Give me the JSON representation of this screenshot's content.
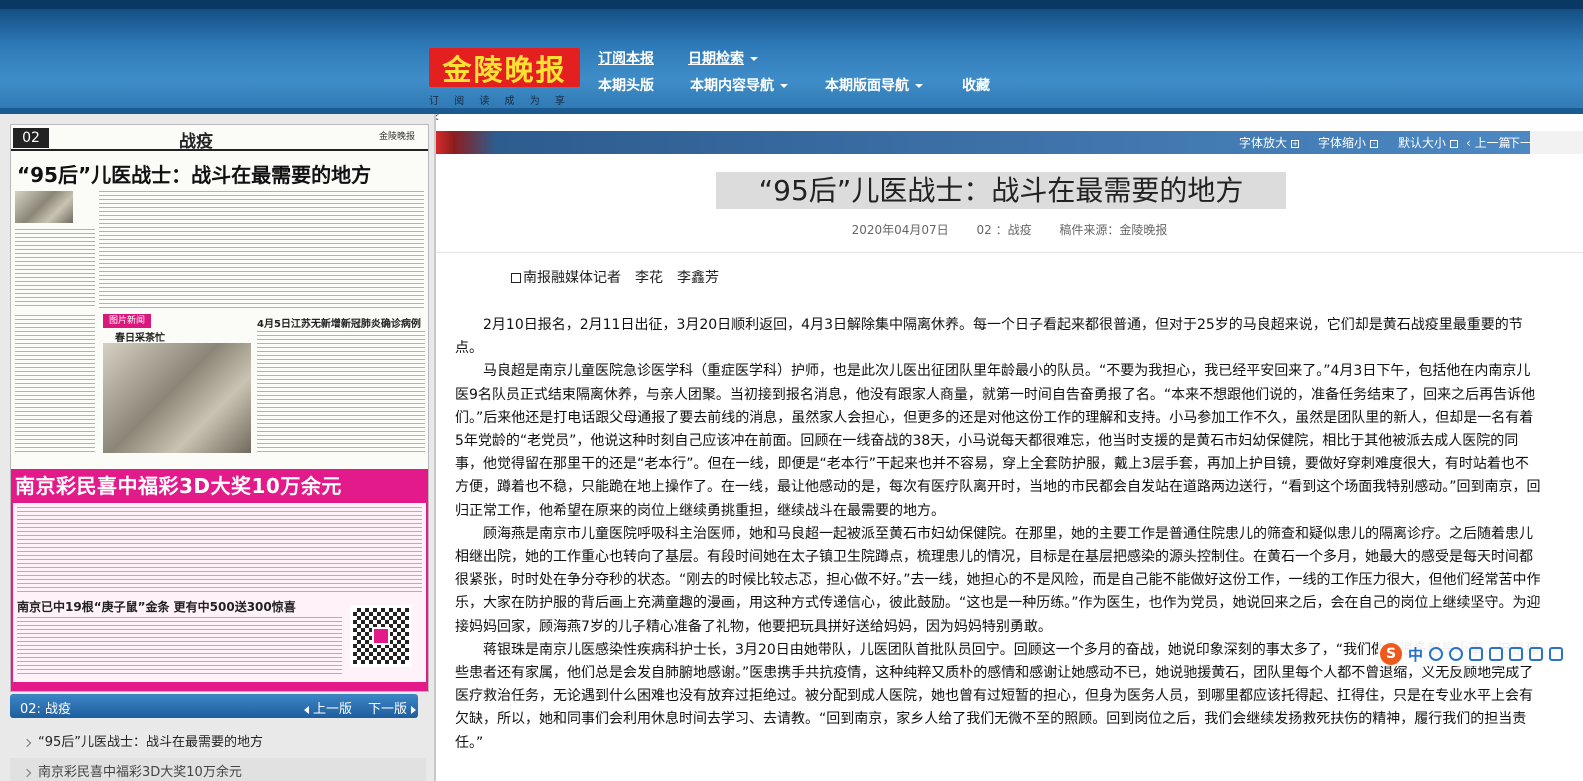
{
  "header": {
    "logo_text": "金陵晚报",
    "logo_slogan": "订 阅 读 成 为 享 受",
    "nav": {
      "subscribe": "订阅本报",
      "date_search": "日期检索",
      "front_page": "本期头版",
      "content_nav": "本期内容导航",
      "layout_nav": "本期版面导航",
      "favorite": "收藏"
    }
  },
  "paper_page": {
    "page_no": "02",
    "section": "战疫",
    "masthead": "金陵晚报",
    "headline": "“95后”儿医战士：战斗在最需要的地方",
    "photo_section_tag": "图片新闻",
    "photo_caption": "春日采茶忙",
    "side_headline": "4月5日江苏无新增新冠肺炎确诊病例",
    "ad_headline": "南京彩民喜中福彩3D大奖10万余元",
    "ad_subheadline": "南京已中19根“庚子鼠”金条 更有中500送300惊喜"
  },
  "pager": {
    "current": "02: 战疫",
    "prev": "上一版",
    "next": "下一版"
  },
  "article_list": [
    {
      "title": "“95后”儿医战士：战斗在最需要的地方"
    },
    {
      "title": "南京彩民喜中福彩3D大奖10万余元"
    }
  ],
  "toolbar": {
    "font_bigger": "字体放大",
    "font_smaller": "字体缩小",
    "font_default": "默认大小",
    "prev_article": "上一篇",
    "next_article": "下一"
  },
  "article": {
    "title": "“95后”儿医战士：战斗在最需要的地方",
    "date": "2020年04月07日",
    "page": "02 ：战疫",
    "source": "稿件来源：金陵晚报",
    "byline": "南报融媒体记者　李花　李鑫芳",
    "paragraphs": [
      "2月10日报名，2月11日出征，3月20日顺利返回，4月3日解除集中隔离休养。每一个日子看起来都很普通，但对于25岁的马良超来说，它们却是黄石战疫里最重要的节点。",
      "马良超是南京儿童医院急诊医学科（重症医学科）护师，也是此次儿医出征团队里年龄最小的队员。“不要为我担心，我已经平安回来了。”4月3日下午，包括他在内南京儿医9名队员正式结束隔离休养，与亲人团聚。当初接到报名消息，他没有跟家人商量，就第一时间自告奋勇报了名。“本来不想跟他们说的，准备任务结束了，回来之后再告诉他们。”后来他还是打电话跟父母通报了要去前线的消息，虽然家人会担心，但更多的还是对他这份工作的理解和支持。小马参加工作不久，虽然是团队里的新人，但却是一名有着5年党龄的“老党员”，他说这种时刻自己应该冲在前面。回顾在一线奋战的38天，小马说每天都很难忘，他当时支援的是黄石市妇幼保健院，相比于其他被派去成人医院的同事，他觉得留在那里干的还是“老本行”。但在一线，即便是“老本行”干起来也并不容易，穿上全套防护服，戴上3层手套，再加上护目镜，要做好穿刺难度很大，有时站着也不方便，蹲着也不稳，只能跪在地上操作了。在一线，最让他感动的是，每次有医疗队离开时，当地的市民都会自发站在道路两边送行，“看到这个场面我特别感动。”回到南京，回归正常工作，他希望在原来的岗位上继续勇挑重担，继续战斗在最需要的地方。",
      "顾海燕是南京市儿童医院呼吸科主治医师，她和马良超一起被派至黄石市妇幼保健院。在那里，她的主要工作是普通住院患儿的筛查和疑似患儿的隔离诊疗。之后随着患儿相继出院，她的工作重心也转向了基层。有段时间她在太子镇卫生院蹲点，梳理患儿的情况，目标是在基层把感染的源头控制住。在黄石一个多月，她最大的感受是每天时间都很紧张，时时处在争分夺秒的状态。“刚去的时候比较忐忑，担心做不好。”去一线，她担心的不是风险，而是自己能不能做好这份工作，一线的工作压力很大，但他们经常苦中作乐，大家在防护服的背后画上充满童趣的漫画，用这种方式传递信心，彼此鼓励。“这也是一种历练。”作为医生，也作为党员，她说回来之后，会在自己的岗位上继续坚守。为迎接妈妈回家，顾海燕7岁的儿子精心准备了礼物，他要把玩具拼好送给妈妈，因为妈妈特别勇敢。",
      "蒋银珠是南京儿医感染性疾病科护士长，3月20日由她带队，儿医团队首批队员回宁。回顾这一个多月的奋战，她说印象深刻的事太多了，“我们做的很多都是小事，但是那些患者还有家属，他们总是会发自肺腑地感谢。”医患携手共抗疫情，这种纯粹又质朴的感情和感谢让她感动不已，她说驰援黄石，团队里每个人都不曾退缩，义无反顾地完成了医疗救治任务，无论遇到什么困难也没有放弃过拒绝过。被分配到成人医院，她也曾有过短暂的担心，但身为医务人员，到哪里都应该托得起、扛得住，只是在专业水平上会有欠缺，所以，她和同事们会利用休息时间去学习、去请教。“回到南京，家乡人给了我们无微不至的照顾。回到岗位之后，我们会继续发扬救死扶伤的精神，履行我们的担当责任。”"
    ]
  },
  "ime": {
    "logo": "S",
    "mode": "中"
  }
}
